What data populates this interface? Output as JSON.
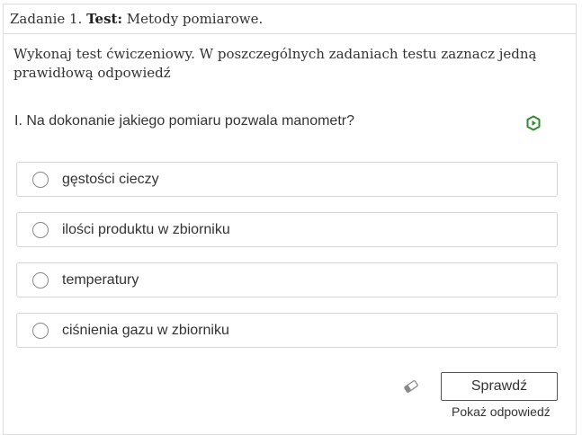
{
  "header": {
    "prefix": "Zadanie 1.",
    "type_label": "Test:",
    "title": "Metody pomiarowe."
  },
  "instructions": "Wykonaj test ćwiczeniowy. W poszczególnych zadaniach testu zaznacz jedną prawidłową odpowiedź",
  "question": {
    "text": "I. Na dokonanie jakiego pomiaru pozwala manometr?",
    "icon": "play-hexagon-icon",
    "icon_color": "#2e8b2e"
  },
  "options": [
    {
      "label": "gęstości cieczy",
      "selected": false
    },
    {
      "label": "ilości produktu w zbiorniku",
      "selected": false
    },
    {
      "label": "temperatury",
      "selected": false
    },
    {
      "label": "ciśnienia gazu w zbiorniku",
      "selected": false
    }
  ],
  "actions": {
    "eraser_icon": "eraser-icon",
    "check_label": "Sprawdź",
    "show_answer_label": "Pokaż odpowiedź"
  }
}
